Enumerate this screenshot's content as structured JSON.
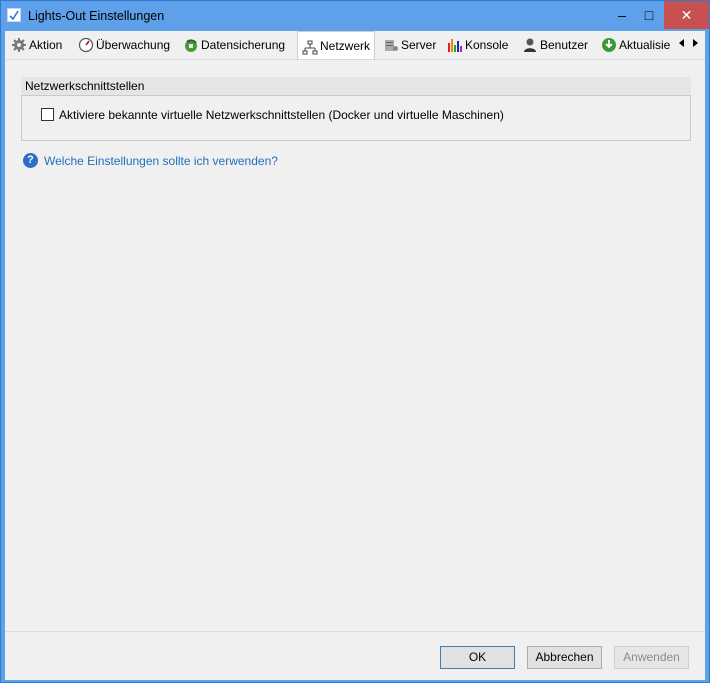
{
  "window": {
    "title": "Lights-Out Einstellungen",
    "minimize_glyph": "–",
    "maximize_glyph": "□",
    "close_glyph": "✕"
  },
  "tabs": [
    {
      "label": "Aktion",
      "icon": "gear-icon"
    },
    {
      "label": "Überwachung",
      "icon": "speedometer-icon"
    },
    {
      "label": "Datensicherung",
      "icon": "backup-icon"
    },
    {
      "label": "Netzwerk",
      "icon": "network-icon",
      "active": true
    },
    {
      "label": "Server",
      "icon": "server-icon"
    },
    {
      "label": "Konsole",
      "icon": "chart-icon"
    },
    {
      "label": "Benutzer",
      "icon": "user-icon"
    },
    {
      "label": "Aktualisie",
      "icon": "download-icon"
    }
  ],
  "page": {
    "group_title": "Netzwerkschnittstellen",
    "checkbox_label": "Aktiviere bekannte virtuelle Netzwerkschnittstellen (Docker und virtuelle Maschinen)",
    "checkbox_checked": false,
    "help_link": "Welche Einstellungen sollte ich verwenden?",
    "help_glyph": "?"
  },
  "buttons": {
    "ok": "OK",
    "cancel": "Abbrechen",
    "apply": "Anwenden"
  },
  "colors": {
    "titlebar": "#5fa0ea",
    "close_button": "#c75050",
    "link": "#1f6fbf"
  }
}
